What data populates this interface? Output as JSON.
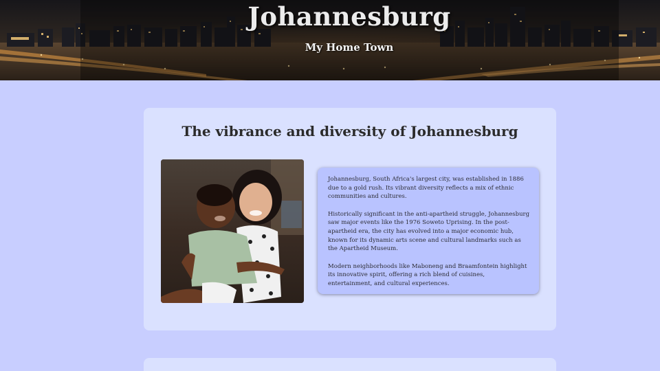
{
  "header": {
    "title": "Johannesburg",
    "subtitle": "My Home Town"
  },
  "section": {
    "heading": "The vibrance and diversity of Johannesburg",
    "image_alt": "Two smiling children hugging",
    "paragraphs": [
      "Johannesburg, South Africa's largest city, was established in 1886 due to a gold rush. Its vibrant diversity reflects a mix of ethnic communities and cultures.",
      "Historically significant in the anti-apartheid struggle, Johannesburg saw major events like the 1976 Soweto Uprising. In the post-apartheid era, the city has evolved into a major economic hub, known for its dynamic arts scene and cultural landmarks such as the Apartheid Museum.",
      "Modern neighborhoods like Maboneng and Braamfontein highlight its innovative spirit, offering a rich blend of cuisines, entertainment, and cultural experiences."
    ]
  },
  "colors": {
    "page_background": "#c8ceff",
    "card_background": "#dae1ff",
    "textbox_background": "#b9c3ff"
  }
}
